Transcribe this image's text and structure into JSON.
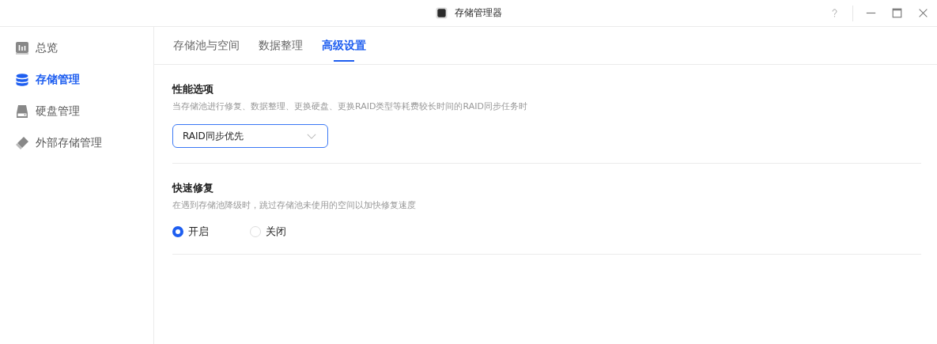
{
  "window": {
    "title": "存储管理器"
  },
  "sidebar": {
    "items": [
      {
        "kind": "overview",
        "label": "总览",
        "selected": false
      },
      {
        "kind": "storage",
        "label": "存储管理",
        "selected": true
      },
      {
        "kind": "disk",
        "label": "硬盘管理",
        "selected": false
      },
      {
        "kind": "external",
        "label": "外部存储管理",
        "selected": false
      }
    ]
  },
  "tabs": [
    {
      "label": "存储池与空间",
      "selected": false
    },
    {
      "label": "数据整理",
      "selected": false
    },
    {
      "label": "高级设置",
      "selected": true
    }
  ],
  "sections": [
    {
      "kind": "select",
      "title": "性能选项",
      "description": "当存储池进行修复、数据整理、更换硬盘、更换RAID类型等耗费较长时间的RAID同步任务时",
      "value": "RAID同步优先"
    },
    {
      "kind": "radio",
      "title": "快速修复",
      "description": "在遇到存储池降级时，跳过存储池未使用的空间以加快修复速度",
      "options": [
        {
          "label": "开启",
          "selected": true
        },
        {
          "label": "关闭",
          "selected": false
        }
      ]
    }
  ]
}
